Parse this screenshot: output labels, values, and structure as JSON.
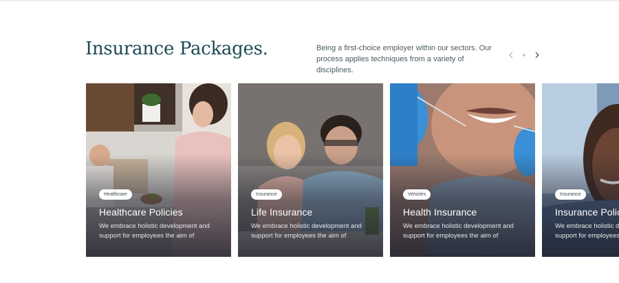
{
  "section": {
    "title": "Insurance Packages.",
    "description": "Being a first-choice employer within our sectors. Our process applies techniques from a variety of disciplines."
  },
  "nav": {
    "prev_icon": "chevron-left-icon",
    "next_icon": "chevron-right-icon"
  },
  "cards": [
    {
      "badge": "Healthcare",
      "title": "Healthcare Policies",
      "description": "We embrace holistic development and support for employees the aim of"
    },
    {
      "badge": "Insurance",
      "title": "Life Insurance",
      "description": "We embrace holistic development and support for employees the aim of"
    },
    {
      "badge": "Vehicles",
      "title": "Health Insurance",
      "description": "We embrace holistic development and support for employees the aim of"
    },
    {
      "badge": "Insurance",
      "title": "Insurance Policies",
      "description": "We embrace holistic development and support for employees the aim of"
    }
  ]
}
